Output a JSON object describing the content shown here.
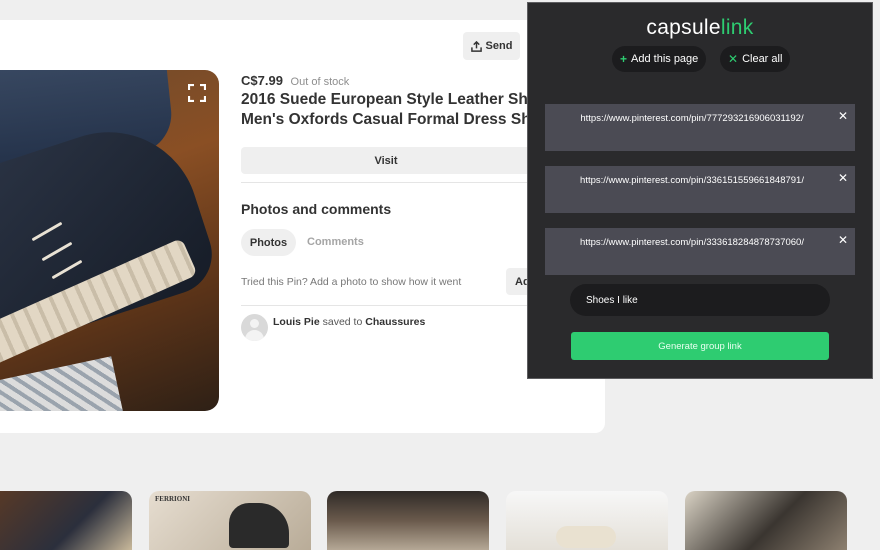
{
  "pin": {
    "price": "C$7.99",
    "stock_status": "Out of stock",
    "title_line1": "2016 Suede European Style Leather Sh",
    "title_line2": "Men's Oxfords Casual Formal Dress Sh",
    "send_label": "Send",
    "visit_label": "Visit",
    "section_title": "Photos and comments",
    "tabs": [
      {
        "label": "Photos",
        "active": true
      },
      {
        "label": "Comments",
        "active": false
      }
    ],
    "tried_text": "Tried this Pin? Add a photo to show how it went",
    "add_label": "Ad",
    "saved_by": {
      "user": "Louis Pie",
      "verb": "saved to",
      "board": "Chaussures"
    }
  },
  "thumbnails": [
    {
      "brand_text": ""
    },
    {
      "brand_text": "FERRIONI"
    },
    {
      "brand_text": ""
    },
    {
      "brand_text": ""
    },
    {
      "brand_text": ""
    }
  ],
  "capsulelink": {
    "logo_part1": "capsule",
    "logo_part2": "link",
    "add_page_label": "Add this page",
    "clear_all_label": "Clear all",
    "links": [
      {
        "url": "https://www.pinterest.com/pin/777293216906031192/"
      },
      {
        "url": "https://www.pinterest.com/pin/336151559661848791/"
      },
      {
        "url": "https://www.pinterest.com/pin/333618284878737060/"
      }
    ],
    "group_name_value": "Shoes I like",
    "generate_label": "Generate group link",
    "accent_color": "#2ecc71"
  }
}
